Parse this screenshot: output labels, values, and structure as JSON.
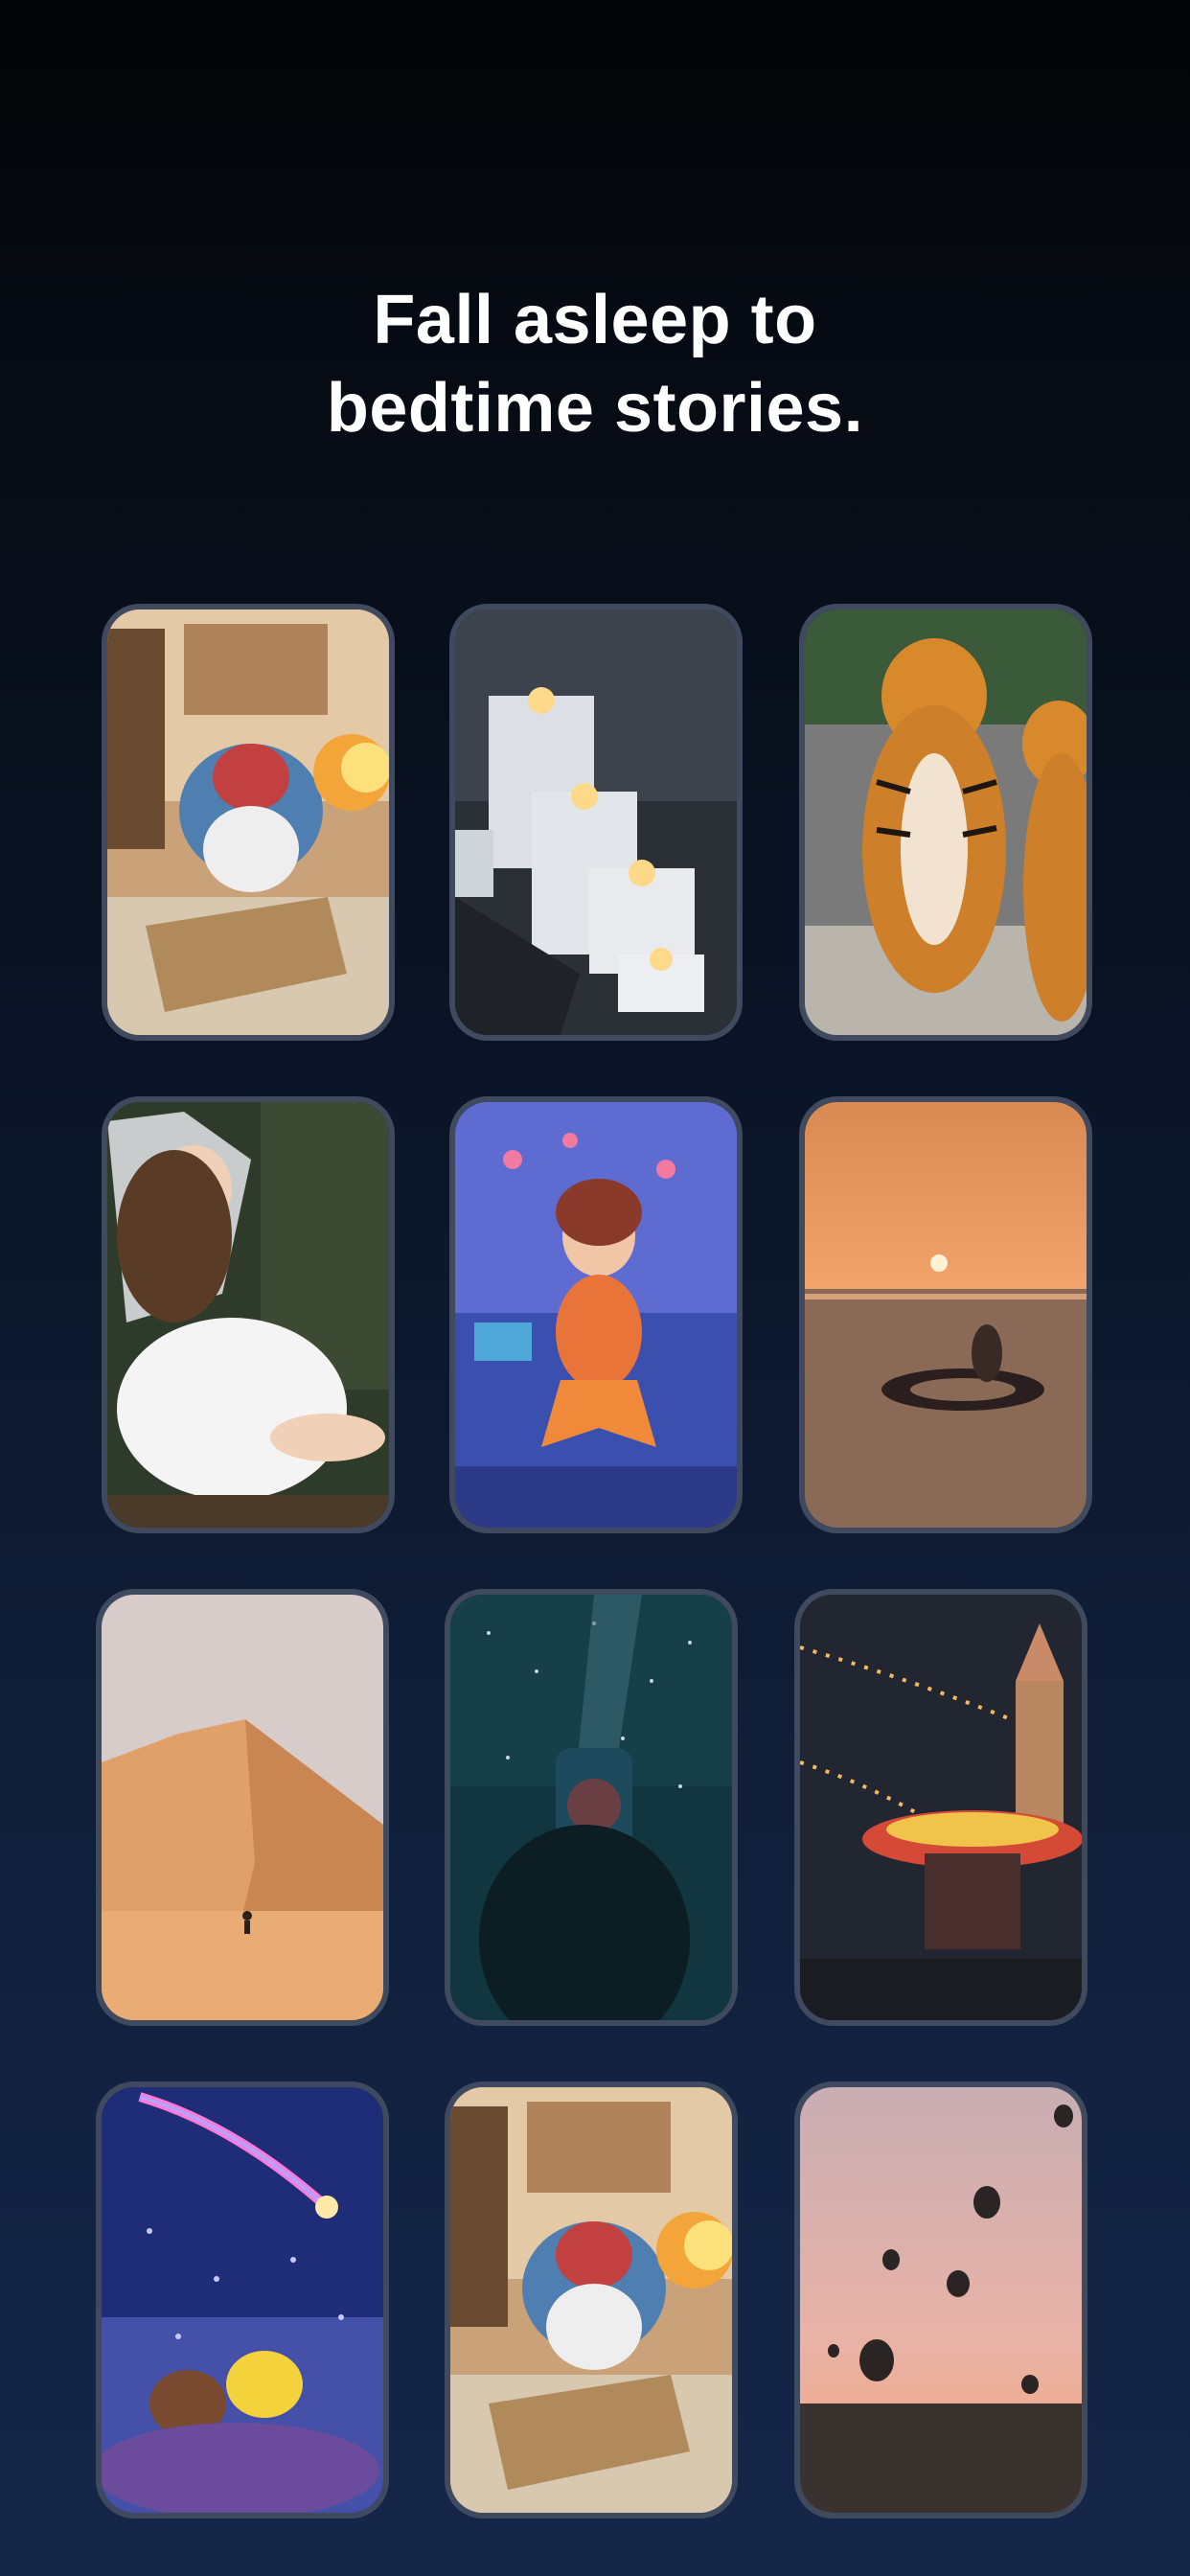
{
  "headline": {
    "line1": "Fall asleep to",
    "line2": "bedtime stories."
  },
  "grid": {
    "cards": [
      {
        "name": "dragon-reading-card",
        "icon": "dragon-illustration"
      },
      {
        "name": "candles-card",
        "icon": "candles-photo"
      },
      {
        "name": "tigers-card",
        "icon": "tigers-photo"
      },
      {
        "name": "fairy-girl-card",
        "icon": "fairy-photo"
      },
      {
        "name": "mermaid-girl-card",
        "icon": "mermaid-illustration"
      },
      {
        "name": "sunset-sea-card",
        "icon": "sunset-sea-photo"
      },
      {
        "name": "desert-dunes-card",
        "icon": "desert-photo"
      },
      {
        "name": "star-jar-card",
        "icon": "star-jar-photo"
      },
      {
        "name": "carousel-night-card",
        "icon": "carousel-photo"
      },
      {
        "name": "shooting-star-kids-card",
        "icon": "shooting-star-illustration"
      },
      {
        "name": "dragon-reading-card-2",
        "icon": "dragon-illustration"
      },
      {
        "name": "hot-air-balloons-card",
        "icon": "balloons-photo"
      }
    ]
  }
}
